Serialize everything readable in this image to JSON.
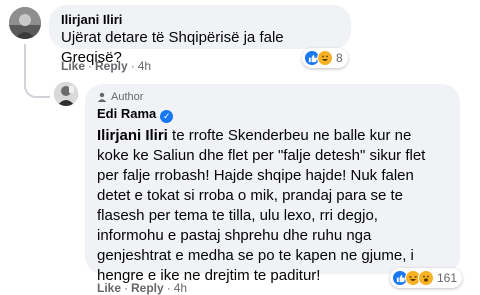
{
  "comment1": {
    "author": "Ilirjani Iliri",
    "text": "Ujërat detare të Shqipërisë ja fale Greqisë?",
    "actions": {
      "like": "Like",
      "reply": "Reply",
      "time": "4h"
    },
    "reactions": {
      "count": "8",
      "types": [
        "like",
        "laugh"
      ]
    }
  },
  "reply1": {
    "badge": "Author",
    "author": "Edi Rama",
    "verified": true,
    "mention": "Ilirjani Iliri",
    "lines": [
      " te rrofte Skenderbeu ne balle kur ne",
      "koke ke Saliun dhe flet per \"falje detesh\" sikur flet",
      "per falje rrobash! Hajde shqipe hajde! Nuk falen",
      "detet e tokat si rroba o mik, prandaj para se te",
      "flasesh per tema te tilla, ulu lexo, rri degjo,",
      "informohu e pastaj shprehu dhe ruhu nga",
      "genjeshtrat e medha se po te kapen ne gjume, i",
      "hengre e ike ne drejtim te paditur!"
    ],
    "actions": {
      "like": "Like",
      "reply": "Reply",
      "time": "4h"
    },
    "reactions": {
      "count": "161",
      "types": [
        "like",
        "laugh",
        "haha"
      ]
    }
  },
  "colors": {
    "bubble": "#f0f2f5",
    "like_blue": "#1877f2",
    "haha_yellow": "#f7b125",
    "meta": "#65676b"
  }
}
